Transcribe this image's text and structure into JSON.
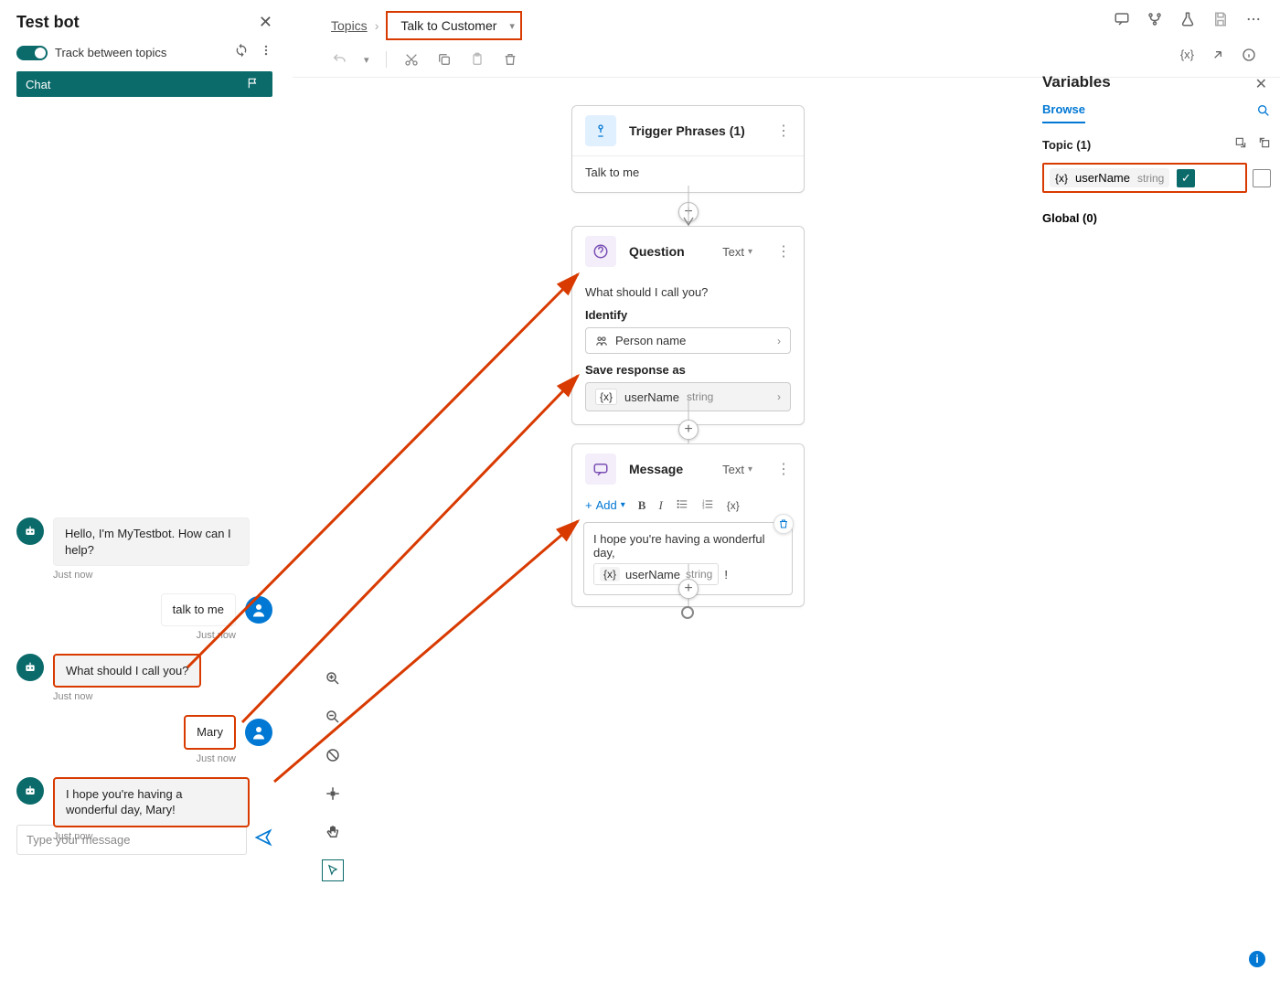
{
  "testbot": {
    "title": "Test bot",
    "track_label": "Track between topics",
    "chat_tab": "Chat",
    "messages": {
      "m1": "Hello, I'm MyTestbot. How can I help?",
      "t1": "Just now",
      "m2": "talk to me",
      "t2": "Just now",
      "m3": "What should I call you?",
      "t3": "Just now",
      "m4": "Mary",
      "t4": "Just now",
      "m5": "I hope you're having a wonderful day, Mary!",
      "t5": "Just now"
    },
    "input_placeholder": "Type your message"
  },
  "breadcrumb": {
    "topics": "Topics",
    "current": "Talk to Customer"
  },
  "nodes": {
    "trigger": {
      "title": "Trigger Phrases (1)",
      "phrase": "Talk to me"
    },
    "question": {
      "title": "Question",
      "type_label": "Text",
      "text": "What should I call you?",
      "identify_label": "Identify",
      "identify_value": "Person name",
      "save_label": "Save response as",
      "var_name": "userName",
      "var_type": "string"
    },
    "message": {
      "title": "Message",
      "type_label": "Text",
      "add_label": "Add",
      "text_line": "I hope you're having a wonderful day,",
      "var_name": "userName",
      "var_type": "string",
      "punct": "!"
    }
  },
  "variables": {
    "title": "Variables",
    "tab": "Browse",
    "topic_section": "Topic (1)",
    "var_name": "userName",
    "var_type": "string",
    "global_section": "Global (0)"
  },
  "toolbar_right": {
    "var_btn": "{x}"
  }
}
